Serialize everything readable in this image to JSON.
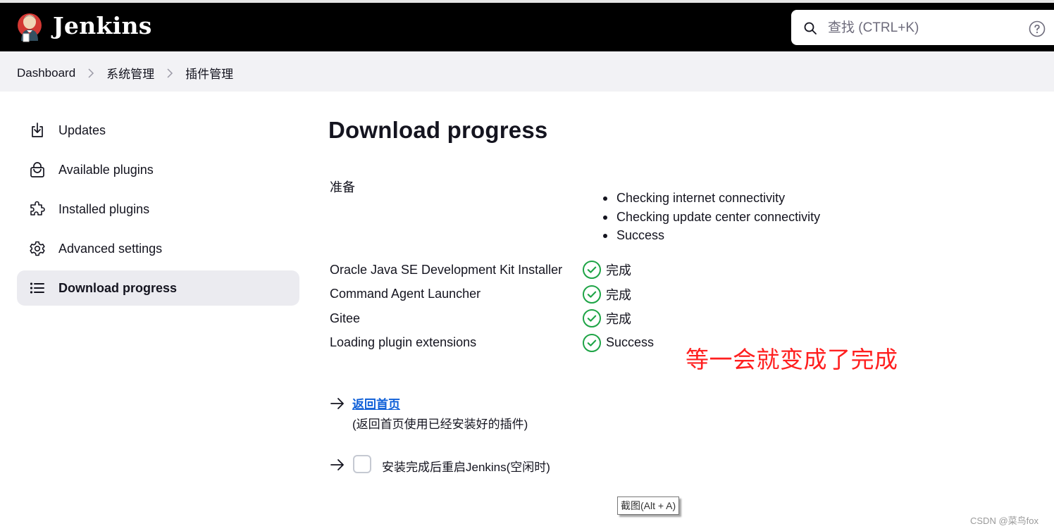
{
  "header": {
    "brand": "Jenkins",
    "logo_icon": "jenkins-butler-logo",
    "search": {
      "placeholder": "查找 (CTRL+K)",
      "value": "",
      "icon": "search-icon"
    },
    "help_icon": "help-icon"
  },
  "breadcrumb": {
    "items": [
      "Dashboard",
      "系统管理",
      "插件管理"
    ],
    "separator_icon": "chevron-right-icon"
  },
  "sidebar": {
    "items": [
      {
        "label": "Updates",
        "icon": "download-icon",
        "active": false
      },
      {
        "label": "Available plugins",
        "icon": "shopping-bag-icon",
        "active": false
      },
      {
        "label": "Installed plugins",
        "icon": "puzzle-icon",
        "active": false
      },
      {
        "label": "Advanced settings",
        "icon": "gear-icon",
        "active": false
      },
      {
        "label": "Download progress",
        "icon": "list-icon",
        "active": true
      }
    ]
  },
  "main": {
    "title": "Download progress",
    "preparation": {
      "label": "准备",
      "steps": [
        "Checking internet connectivity",
        "Checking update center connectivity",
        "Success"
      ]
    },
    "jobs": [
      {
        "name": "Oracle Java SE Development Kit Installer",
        "status": "完成",
        "status_icon": "check-circle-icon"
      },
      {
        "name": "Command Agent Launcher",
        "status": "完成",
        "status_icon": "check-circle-icon"
      },
      {
        "name": "Gitee",
        "status": "完成",
        "status_icon": "check-circle-icon"
      },
      {
        "name": "Loading plugin extensions",
        "status": "Success",
        "status_icon": "check-circle-icon"
      }
    ],
    "go_home": {
      "link": "返回首页",
      "description": "(返回首页使用已经安装好的插件)"
    },
    "restart": {
      "label": "安装完成后重启Jenkins(空闲时)",
      "checked": false
    }
  },
  "annotation": "等一会就变成了完成",
  "tooltip": "截图(Alt + A)",
  "watermark": "CSDN @菜鸟fox",
  "colors": {
    "header_bg": "#000000",
    "breadcrumb_bg": "#f2f2f5",
    "active_item_bg": "#ebebf0",
    "success": "#1ea446",
    "link": "#0e5fd8",
    "annotation": "#ff1f1f"
  }
}
